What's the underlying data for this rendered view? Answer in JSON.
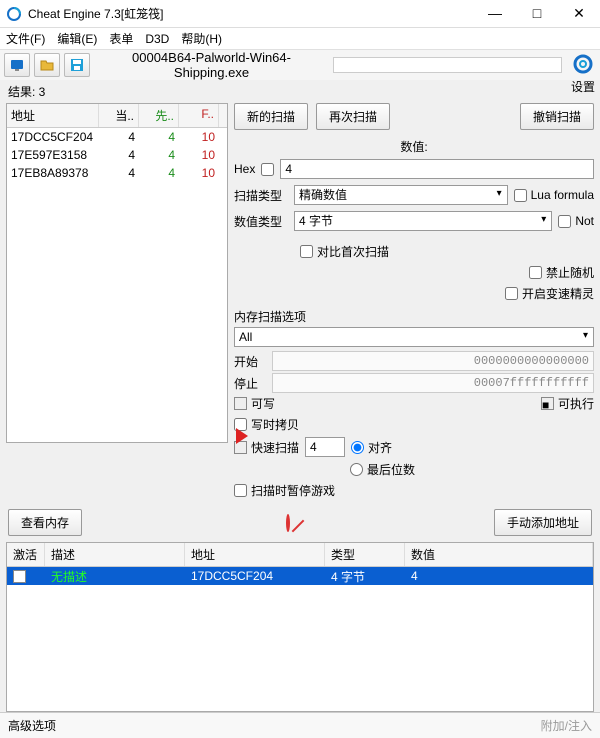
{
  "window": {
    "title": "Cheat Engine 7.3[虹笼筏]"
  },
  "menu": {
    "file": "文件(F)",
    "edit": "编辑(E)",
    "table": "表单",
    "d3d": "D3D",
    "help": "帮助(H)"
  },
  "process": {
    "name": "00004B64-Palworld-Win64-Shipping.exe"
  },
  "settings_label": "设置",
  "results_label": "结果: 3",
  "results": {
    "cols": {
      "addr": "地址",
      "cur": "当..",
      "prev": "先..",
      "first": "F.."
    },
    "rows": [
      {
        "addr": "17DCC5CF204",
        "cur": "4",
        "prev": "4",
        "first": "10"
      },
      {
        "addr": "17E597E3158",
        "cur": "4",
        "prev": "4",
        "first": "10"
      },
      {
        "addr": "17EB8A89378",
        "cur": "4",
        "prev": "4",
        "first": "10"
      }
    ]
  },
  "scan": {
    "new": "新的扫描",
    "next": "再次扫描",
    "undo": "撤销扫描",
    "value_label": "数值:",
    "hex_label": "Hex",
    "value": "4",
    "scan_type_label": "扫描类型",
    "scan_type": "精确数值",
    "value_type_label": "数值类型",
    "value_type": "4 字节",
    "lua": "Lua formula",
    "not": "Not",
    "compare_first": "对比首次扫描",
    "no_random": "禁止随机",
    "speed_wizard": "开启变速精灵"
  },
  "memopt": {
    "title": "内存扫描选项",
    "all": "All",
    "start_lbl": "开始",
    "start": "0000000000000000",
    "stop_lbl": "停止",
    "stop": "00007fffffffffff",
    "writable": "可写",
    "executable": "可执行",
    "cow": "写时拷贝",
    "fast": "快速扫描",
    "fast_val": "4",
    "align": "对齐",
    "lastdigits": "最后位数",
    "pause": "扫描时暂停游戏"
  },
  "mid": {
    "view_mem": "查看内存",
    "add_manual": "手动添加地址"
  },
  "cheat": {
    "cols": {
      "active": "激活",
      "desc": "描述",
      "addr": "地址",
      "type": "类型",
      "value": "数值"
    },
    "rows": [
      {
        "desc": "无描述",
        "addr": "17DCC5CF204",
        "type": "4 字节",
        "value": "4"
      }
    ]
  },
  "footer": {
    "adv": "高级选项",
    "attach": "附加/注入"
  }
}
